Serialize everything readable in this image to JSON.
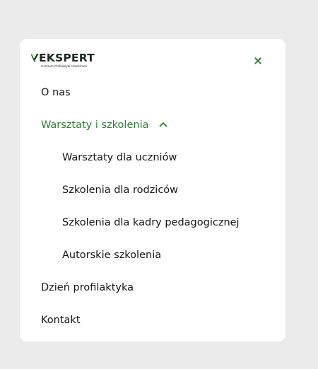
{
  "logo": {
    "wordmark": "EKSPERT",
    "tagline": "Centrum Profilaktyki Uzależnień",
    "brand_color": "#2e7d32"
  },
  "menu": {
    "close_icon": "close-icon",
    "items": [
      {
        "label": "O nas"
      },
      {
        "label": "Warsztaty i szkolenia",
        "expanded": true,
        "icon": "chevron-up-icon",
        "children": [
          {
            "label": "Warsztaty dla uczniów"
          },
          {
            "label": "Szkolenia dla rodziców"
          },
          {
            "label": "Szkolenia dla kadry pedagogicznej"
          },
          {
            "label": "Autorskie szkolenia"
          }
        ]
      },
      {
        "label": "Dzień profilaktyka"
      },
      {
        "label": "Kontakt"
      }
    ]
  }
}
